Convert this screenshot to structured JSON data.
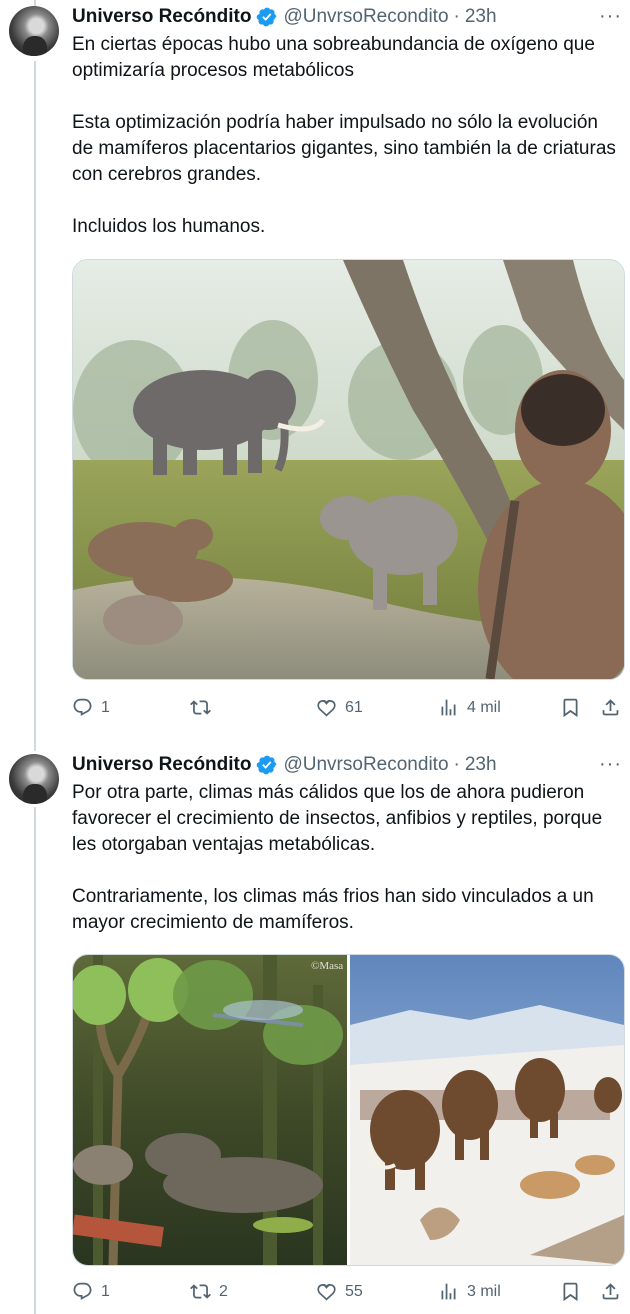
{
  "tweets": [
    {
      "author": "Universo Recóndito",
      "handle": "@UnvrsoRecondito",
      "separator": "·",
      "time": "23h",
      "more": "···",
      "text": "En ciertas épocas hubo una sobreabundancia de oxígeno que optimizaría procesos metabólicos\n\nEsta optimización podría haber impulsado no sólo la evolución de mamíferos placentarios gigantes, sino también la de criaturas con cerebros grandes.\n\nIncluidos los humanos.",
      "stats": {
        "replies": "1",
        "reposts": "",
        "likes": "61",
        "views": "4 mil"
      }
    },
    {
      "author": "Universo Recóndito",
      "handle": "@UnvrsoRecondito",
      "separator": "·",
      "time": "23h",
      "more": "···",
      "text": "Por otra parte, climas más cálidos que los de ahora pudieron favorecer el crecimiento de insectos, anfibios y reptiles, porque les otorgaban ventajas metabólicas.\n\nContrariamente, los climas más frios han sido vinculados a un mayor crecimiento de mamíferos.",
      "image_watermark": "©Masa",
      "stats": {
        "replies": "1",
        "reposts": "2",
        "likes": "55",
        "views": "3 mil"
      }
    }
  ],
  "icons": [
    "reply-icon",
    "repost-icon",
    "like-icon",
    "views-icon",
    "bookmark-icon",
    "share-icon",
    "verified-badge-icon",
    "more-icon"
  ],
  "colors": {
    "text": "#0f1419",
    "secondary": "#536471",
    "verified": "#1d9bf0",
    "border": "#cfd9de"
  }
}
